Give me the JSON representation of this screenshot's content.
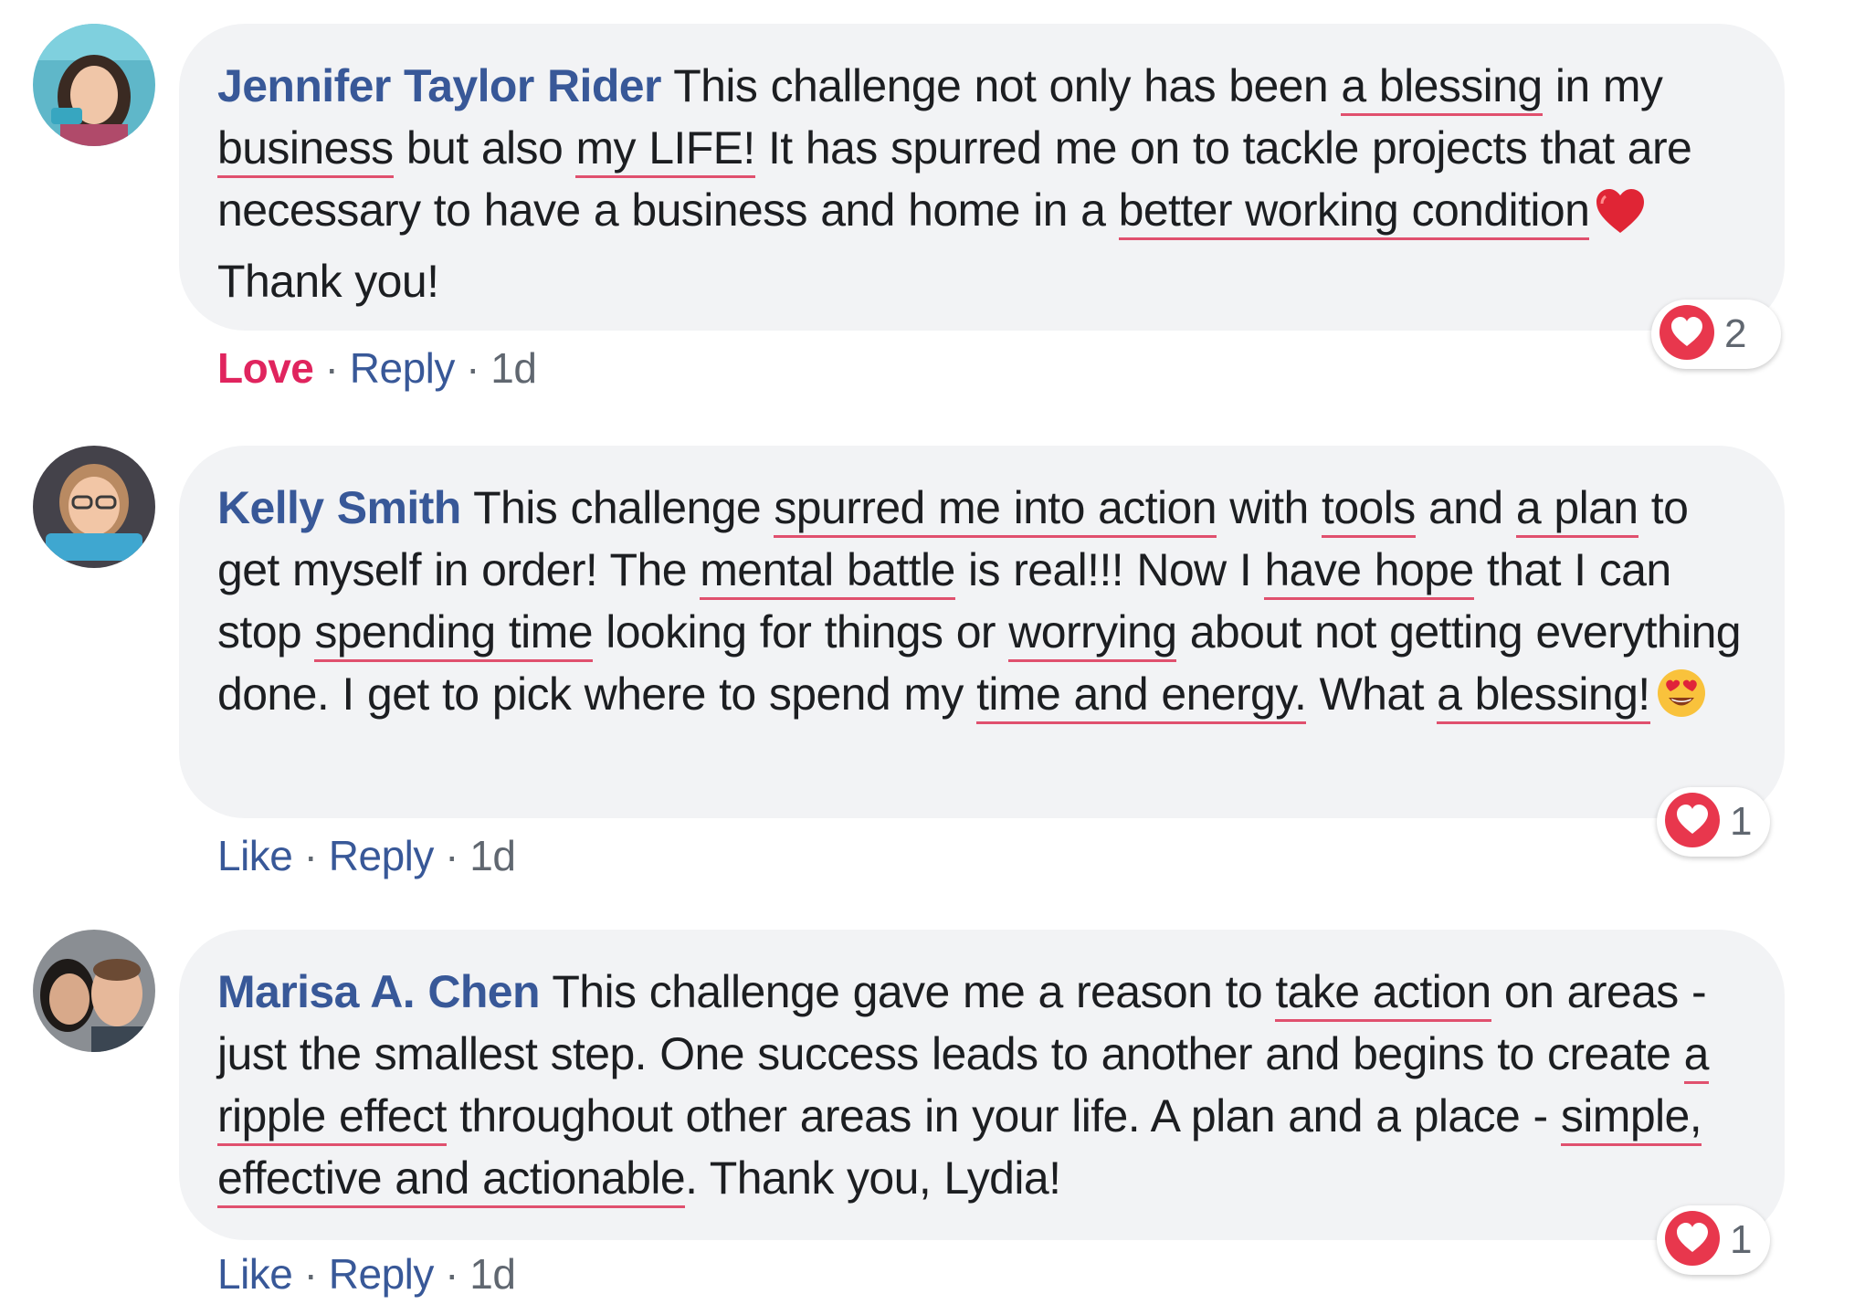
{
  "comments": [
    {
      "author": "Jennifer Taylor Rider",
      "segments": [
        {
          "t": " This challenge not only has been "
        },
        {
          "t": "a blessing",
          "hl": true
        },
        {
          "t": " in my "
        },
        {
          "t": "business",
          "hl": true
        },
        {
          "t": " but also "
        },
        {
          "t": "my LIFE!",
          "hl": true
        },
        {
          "t": " It has spurred me on to tackle projects that are necessary to have a business and home in a "
        },
        {
          "t": "better working condition",
          "hl": true
        },
        {
          "emoji": "red-heart"
        },
        {
          "t": "Thank you!"
        }
      ],
      "reaction": {
        "icon": "love-reaction-icon",
        "count": "2"
      },
      "action_primary": "Love",
      "action_primary_type": "love",
      "reply_label": "Reply",
      "separator": " · ",
      "timestamp": "1d"
    },
    {
      "author": "Kelly Smith",
      "segments": [
        {
          "t": " This challenge "
        },
        {
          "t": "spurred me into action",
          "hl": true
        },
        {
          "t": " with "
        },
        {
          "t": "tools",
          "hl": true
        },
        {
          "t": " and "
        },
        {
          "t": "a plan",
          "hl": true
        },
        {
          "t": " to get myself in order! The "
        },
        {
          "t": "mental battle",
          "hl": true
        },
        {
          "t": " is real!!! Now I "
        },
        {
          "t": "have hope",
          "hl": true
        },
        {
          "t": " that I can stop "
        },
        {
          "t": "spending time",
          "hl": true
        },
        {
          "t": " looking for things or "
        },
        {
          "t": "worrying",
          "hl": true
        },
        {
          "t": " about not getting everything done. I get to pick where to spend my "
        },
        {
          "t": "time and energy.",
          "hl": true
        },
        {
          "t": " What "
        },
        {
          "t": "a blessing!",
          "hl": true
        },
        {
          "emoji": "heart-eyes"
        }
      ],
      "reaction": {
        "icon": "love-reaction-icon",
        "count": "1"
      },
      "action_primary": "Like",
      "action_primary_type": "like",
      "reply_label": "Reply",
      "separator": " · ",
      "timestamp": "1d"
    },
    {
      "author": "Marisa A. Chen",
      "segments": [
        {
          "t": " This challenge gave me a reason to "
        },
        {
          "t": "take action",
          "hl": true
        },
        {
          "t": " on areas - just the smallest step. One success leads to another and begins to create "
        },
        {
          "t": "a ripple effect",
          "hl": true
        },
        {
          "t": " throughout other areas in your life. A plan and a place - "
        },
        {
          "t": "simple, effective and actionable",
          "hl": true
        },
        {
          "t": ". Thank you, Lydia!"
        }
      ],
      "reaction": {
        "icon": "love-reaction-icon",
        "count": "1"
      },
      "action_primary": "Like",
      "action_primary_type": "like",
      "reply_label": "Reply",
      "separator": " · ",
      "timestamp": "1d"
    }
  ],
  "colors": {
    "author_link": "#385898",
    "love": "#e0245e",
    "underline": "#e0506e",
    "bubble": "#f2f3f5",
    "meta": "#606770"
  }
}
